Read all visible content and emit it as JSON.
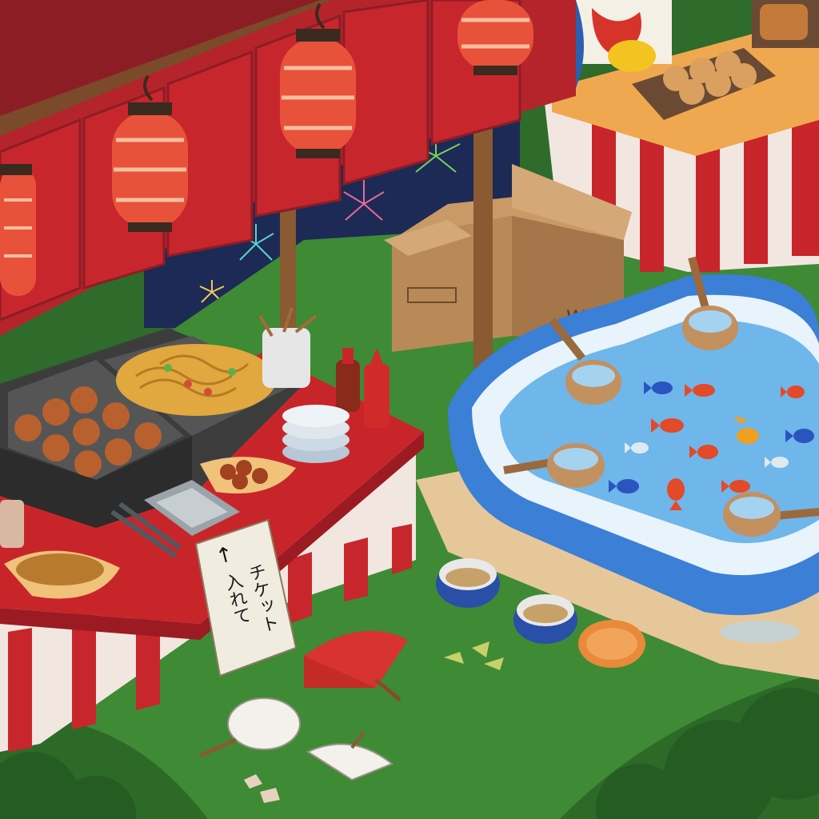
{
  "scene": {
    "title": "",
    "sign": {
      "arrow": "↑",
      "line1": "チケット",
      "line2": "入れて"
    },
    "box_label": "WEISO"
  },
  "colors": {
    "grass": "#3f8a35",
    "grass_dark": "#2d6a28",
    "stall_red": "#c8252b",
    "stall_white": "#f2e6e0",
    "lantern": "#e9523a",
    "pool_blue": "#3b82d9",
    "water": "#6fb6ea",
    "sky": "#1c2a55"
  },
  "icons": {
    "lanterns": [
      "paper-lantern-icon",
      "paper-lantern-icon",
      "paper-lantern-icon",
      "paper-lantern-icon",
      "paper-lantern-icon"
    ],
    "fans": [
      "red-fan-icon",
      "white-fan-icon",
      "white-fan-icon"
    ],
    "ladles": [
      "ladle-icon",
      "ladle-icon",
      "ladle-icon",
      "ladle-icon"
    ],
    "fish": [
      "goldfish-icon"
    ]
  }
}
